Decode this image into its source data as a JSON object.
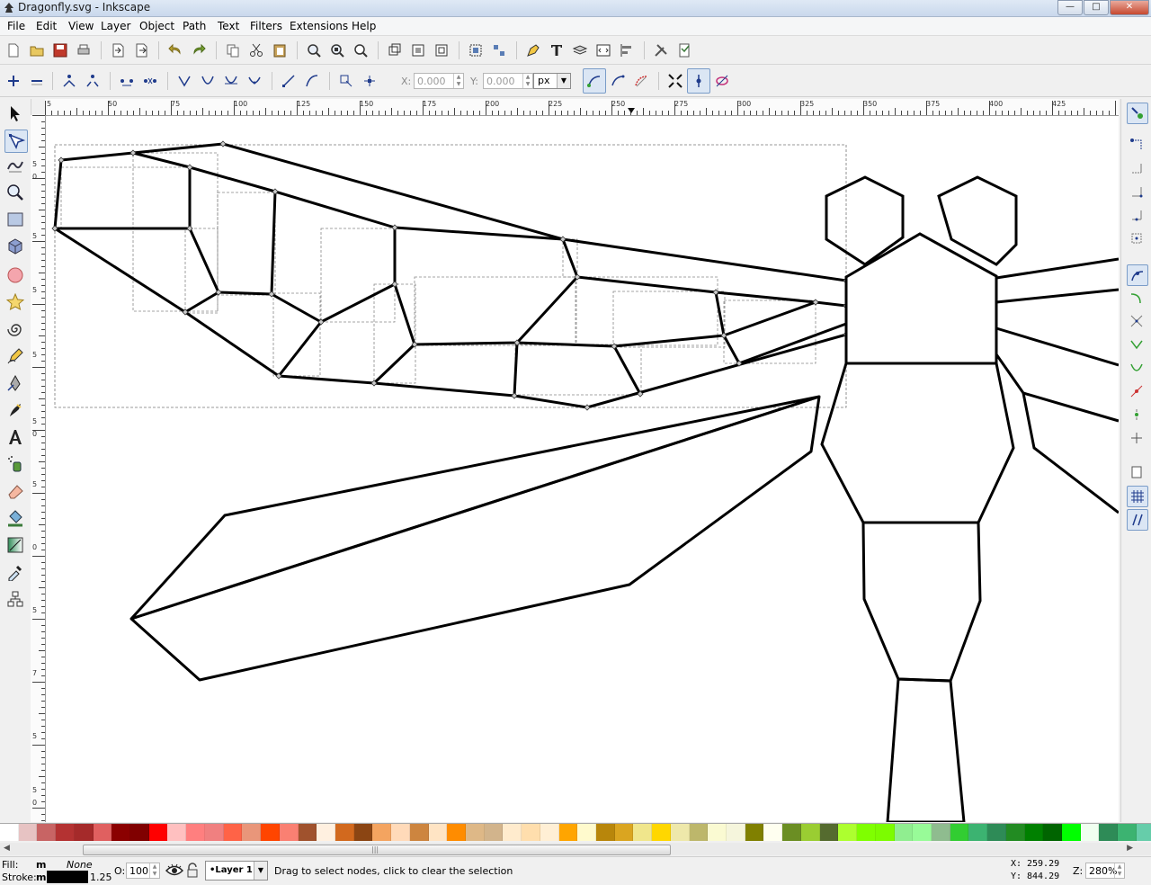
{
  "window": {
    "title": "Dragonfly.svg - Inkscape",
    "buttons": {
      "minimize": "—",
      "maximize": "□",
      "close": "✕"
    }
  },
  "menu": [
    "File",
    "Edit",
    "View",
    "Layer",
    "Object",
    "Path",
    "Text",
    "Filters",
    "Extensions",
    "Help"
  ],
  "node_controls": {
    "x_label": "X:",
    "x_value": "0.000",
    "y_label": "Y:",
    "y_value": "0.000",
    "unit": "px"
  },
  "ruler": {
    "top_labels": [
      "5",
      "50",
      "75",
      "100",
      "125",
      "150",
      "175",
      "200",
      "225",
      "250",
      "275",
      "300",
      "325",
      "350",
      "375",
      "400",
      "425"
    ],
    "left_labels": [
      "5",
      "0",
      "5",
      "5",
      "5",
      "5",
      "0",
      "5",
      "0",
      "5",
      "7",
      "5",
      "5",
      "0"
    ]
  },
  "palette": {
    "colors": [
      "#ffffff",
      "#e7c3c3",
      "#c86464",
      "#b43232",
      "#a52a2a",
      "#e06060",
      "#8b0000",
      "#800000",
      "#ff0000",
      "#ffc0c0",
      "#ff7f7f",
      "#f08080",
      "#ff6347",
      "#e9967a",
      "#ff4500",
      "#fa8072",
      "#a0522d",
      "#fff0e0",
      "#d2691e",
      "#8b4513",
      "#f4a460",
      "#ffdab9",
      "#cd853f",
      "#ffe4c4",
      "#ff8c00",
      "#deb887",
      "#d2b48c",
      "#ffebcd",
      "#ffdead",
      "#ffefd5",
      "#ffa500",
      "#fffacd",
      "#b8860b",
      "#daa520",
      "#f0e68c",
      "#ffd700",
      "#eee8aa",
      "#bdb76b",
      "#fafad2",
      "#f5f5dc",
      "#808000",
      "#fffff0",
      "#6b8e23",
      "#9acd32",
      "#556b2f",
      "#adff2f",
      "#7fff00",
      "#7cfc00",
      "#90ee90",
      "#98fb98",
      "#8fbc8f",
      "#32cd32",
      "#3cb371",
      "#2e8b57",
      "#228b22",
      "#008000",
      "#006400",
      "#00ff00",
      "#f0fff0",
      "#2e8b57",
      "#3cb371",
      "#66cdaa",
      "#00fa9a",
      "#00ff7f"
    ]
  },
  "status": {
    "fill_label": "Fill:",
    "fill_value": "m",
    "fill_none": "None",
    "stroke_label": "Stroke:",
    "stroke_value": "m",
    "stroke_width": "1.25",
    "opacity_label": "O:",
    "opacity_value": "100",
    "layer": "•Layer 1",
    "message": "Drag to select nodes, click to clear the selection",
    "x_label": "X:",
    "x_value": "259.29",
    "y_label": "Y:",
    "y_value": "844.29",
    "zoom_label": "Z:",
    "zoom_value": "280%"
  }
}
